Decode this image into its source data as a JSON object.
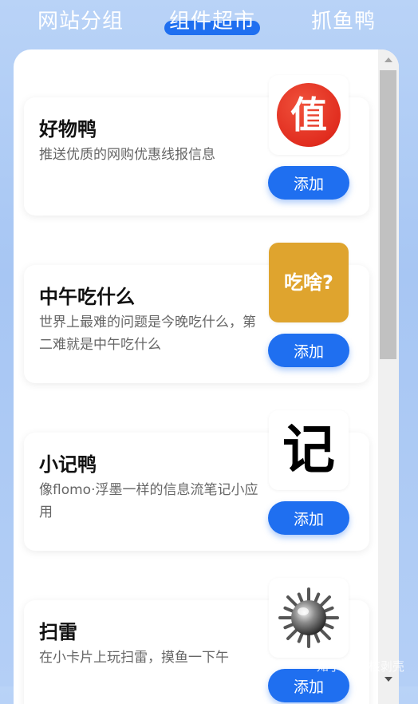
{
  "tabs": [
    {
      "label": "网站分组",
      "active": false
    },
    {
      "label": "组件超市",
      "active": true
    },
    {
      "label": "抓鱼鸭",
      "active": false
    }
  ],
  "accent_color": "#1f6ff0",
  "cards": [
    {
      "title": "好物鸭",
      "description": "推送优质的网购优惠线报信息",
      "icon": "zhi-red-circle-icon",
      "icon_text": "值",
      "button_label": "添加"
    },
    {
      "title": "中午吃什么",
      "description": "世界上最难的问题是今晚吃什么，第二难就是中午吃什么",
      "icon": "chisha-icon",
      "icon_text": "吃啥?",
      "button_label": "添加"
    },
    {
      "title": "小记鸭",
      "description": "像flomo·浮墨一样的信息流笔记小应用",
      "icon": "ji-icon",
      "icon_text": "记",
      "button_label": "添加"
    },
    {
      "title": "扫雷",
      "description": "在小卡片上玩扫雷，摸鱼一下午",
      "icon": "minesweeper-mine-icon",
      "button_label": "添加"
    }
  ],
  "watermark": "知乎 @果核剥壳"
}
